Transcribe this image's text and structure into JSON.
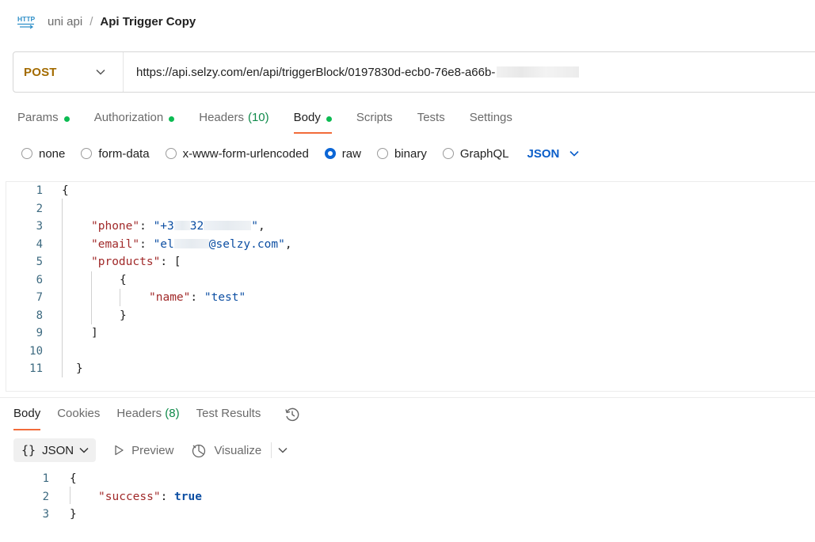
{
  "header": {
    "icon": "http-icon",
    "collection": "uni api",
    "separator": "/",
    "request_name": "Api Trigger Copy"
  },
  "request": {
    "method": "POST",
    "url": "https://api.selzy.com/en/api/triggerBlock/0197830d-ecb0-76e8-a66b-"
  },
  "request_tabs": [
    {
      "label": "Params",
      "dot": true
    },
    {
      "label": "Authorization",
      "dot": true
    },
    {
      "label": "Headers",
      "count": "(10)"
    },
    {
      "label": "Body",
      "dot": true,
      "active": true
    },
    {
      "label": "Scripts"
    },
    {
      "label": "Tests"
    },
    {
      "label": "Settings"
    }
  ],
  "body_types": [
    {
      "label": "none",
      "selected": false
    },
    {
      "label": "form-data",
      "selected": false
    },
    {
      "label": "x-www-form-urlencoded",
      "selected": false
    },
    {
      "label": "raw",
      "selected": true
    },
    {
      "label": "binary",
      "selected": false
    },
    {
      "label": "GraphQL",
      "selected": false
    }
  ],
  "body_language": "JSON",
  "request_body": {
    "line_numbers": [
      "1",
      "2",
      "3",
      "4",
      "5",
      "6",
      "7",
      "8",
      "9",
      "10",
      "11"
    ],
    "open_brace": "{",
    "phone_key": "\"phone\"",
    "phone_value_start": "\"+3",
    "phone_value_mid": "32",
    "phone_value_end": "\"",
    "email_key": "\"email\"",
    "email_value_start": "\"el",
    "email_value_end": "@selzy.com\"",
    "products_key": "\"products\"",
    "name_key": "\"name\"",
    "name_value": "\"test\"",
    "close_bracket": "]",
    "close_brace": "}"
  },
  "response_tabs": [
    {
      "label": "Body",
      "active": true
    },
    {
      "label": "Cookies"
    },
    {
      "label": "Headers",
      "count": "(8)"
    },
    {
      "label": "Test Results"
    }
  ],
  "response_toolbar": {
    "format": "JSON",
    "preview": "Preview",
    "visualize": "Visualize"
  },
  "response_body": {
    "line_numbers": [
      "1",
      "2",
      "3"
    ],
    "open_brace": "{",
    "success_key": "\"success\"",
    "success_value": "true",
    "close_brace": "}"
  },
  "colors": {
    "method": "#a36b00",
    "active_tab_underline": "#f26b3a",
    "status_dot": "#0cbb52",
    "json_key": "#a12a2a",
    "json_string": "#0d4fa3",
    "accent_blue": "#0b66d6"
  }
}
